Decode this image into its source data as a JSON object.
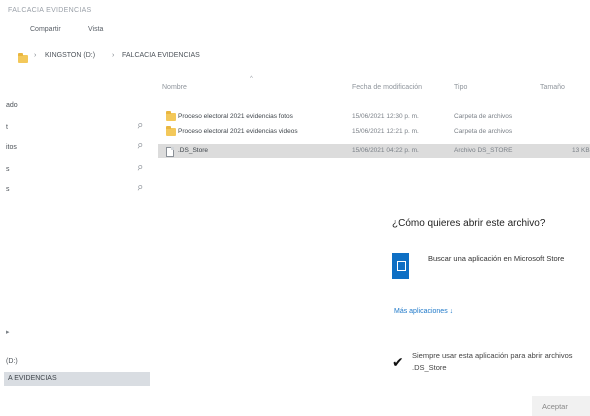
{
  "window": {
    "title": "FALCACIA EVIDENCIAS"
  },
  "ribbon": {
    "tabs": [
      "Compartir",
      "Vista"
    ]
  },
  "address": {
    "crumbs": [
      "KINGSTON (D:)",
      "FALCACIA EVIDENCIAS"
    ],
    "separator": "›"
  },
  "sidebar": {
    "items": [
      "ado",
      "t",
      "itos",
      "s",
      "s"
    ],
    "drive": "(D:)",
    "selected": "A EVIDENCIAS",
    "pin_glyph": "⚲",
    "expander": "▸"
  },
  "filelist": {
    "columns": {
      "name": "Nombre",
      "date": "Fecha de modificación",
      "type": "Tipo",
      "size": "Tamaño"
    },
    "sort_indicator": "^",
    "rows": [
      {
        "name": "Proceso electoral 2021 evidencias fotos",
        "date": "15/06/2021 12:30 p. m.",
        "type": "Carpeta de archivos",
        "size": "",
        "icon": "folder-icon"
      },
      {
        "name": "Proceso electoral 2021 evidencias videos",
        "date": "15/06/2021 12:21 p. m.",
        "type": "Carpeta de archivos",
        "size": "",
        "icon": "folder-icon"
      },
      {
        "name": ".DS_Store",
        "date": "15/06/2021 04:22 p. m.",
        "type": "Archivo DS_STORE",
        "size": "13 KB",
        "icon": "file-icon"
      }
    ]
  },
  "dialog": {
    "heading": "¿Cómo quieres abrir este archivo?",
    "store_option": "Buscar una aplicación en Microsoft Store",
    "more_apps": "Más aplicaciones ↓",
    "always_checked": true,
    "check_glyph": "✔",
    "always_text": "Siempre usar esta aplicación para abrir archivos .DS_Store",
    "ok_label": "Aceptar"
  }
}
